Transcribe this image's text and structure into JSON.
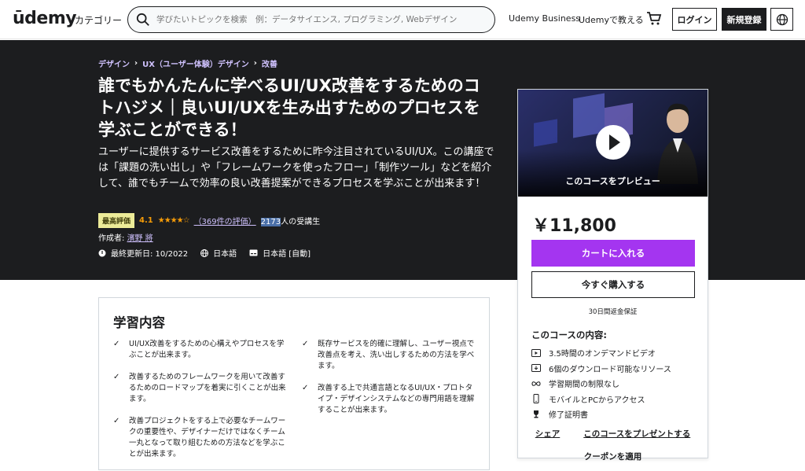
{
  "header": {
    "logo": "ūdemy",
    "categories": "カテゴリー",
    "search_placeholder": "学びたいトピックを検索　例：データサイエンス, プログラミング, Webデザイン",
    "udemy_business": "Udemy Business",
    "teach": "Udemyで教える",
    "login": "ログイン",
    "signup": "新規登録"
  },
  "breadcrumb": [
    "デザイン",
    "UX（ユーザー体験）デザイン",
    "改善"
  ],
  "course": {
    "title": "誰でもかんたんに学べるUI/UX改善をするためのコトハジメ｜良いUI/UXを生み出すためのプロセスを学ぶことができる！",
    "subtitle": "ユーザーに提供するサービス改善をするために昨今注目されているUI/UX。この講座では「課題の洗い出し」や「フレームワークを使ったフロー」「制作ツール」などを紹介して、誰でもチームで効率の良い改善提案ができるプロセスを学ぶことが出来ます！",
    "badge": "最高評価",
    "rating": "4.1",
    "stars": "★★★★☆",
    "rating_count": "（369件の評価）",
    "students_number": "2173",
    "students_suffix": "人の受講生",
    "author_prefix": "作成者: ",
    "author": "濱野 將",
    "updated": "最終更新日: 10/2022",
    "language": "日本語",
    "captions": "日本語 [自動]"
  },
  "card": {
    "preview_label": "このコースをプレビュー",
    "price": "￥11,800",
    "add_to_cart": "カートに入れる",
    "buy_now": "今すぐ購入する",
    "guarantee": "30日間返金保証",
    "includes_title": "このコースの内容:",
    "includes": [
      {
        "icon": "video-icon",
        "text": "3.5時間のオンデマンドビデオ"
      },
      {
        "icon": "download-icon",
        "text": "6個のダウンロード可能なリソース"
      },
      {
        "icon": "infinity-icon",
        "text": "学習期間の制限なし"
      },
      {
        "icon": "mobile-icon",
        "text": "モバイルとPCからアクセス"
      },
      {
        "icon": "trophy-icon",
        "text": "修了証明書"
      }
    ],
    "share": "シェア",
    "gift": "このコースをプレゼントする",
    "coupon": "クーポンを適用"
  },
  "learn": {
    "title": "学習内容",
    "left": [
      "UI/UX改善をするための心構えやプロセスを学ぶことが出来ます。",
      "改善するためのフレームワークを用いて改善するためのロードマップを着実に引くことが出来ます。",
      "改善プロジェクトをする上で必要なチームワークの重要性や、デザイナーだけではなくチーム一丸となって取り組むための方法などを学ぶことが出来ます。"
    ],
    "right": [
      "既存サービスを的確に理解し、ユーザー視点で改善点を考え、洗い出しするための方法を学べます。",
      "改善する上で共通言語となるUI/UX・プロトタイプ・デザインシステムなどの専門用語を理解することが出来ます。"
    ]
  },
  "colors": {
    "accent_purple": "#a435f0",
    "hero_bg": "#1c1d1f",
    "link_lavender": "#cec0fc",
    "star_orange": "#f69c08",
    "badge_bg": "#eceb98"
  }
}
